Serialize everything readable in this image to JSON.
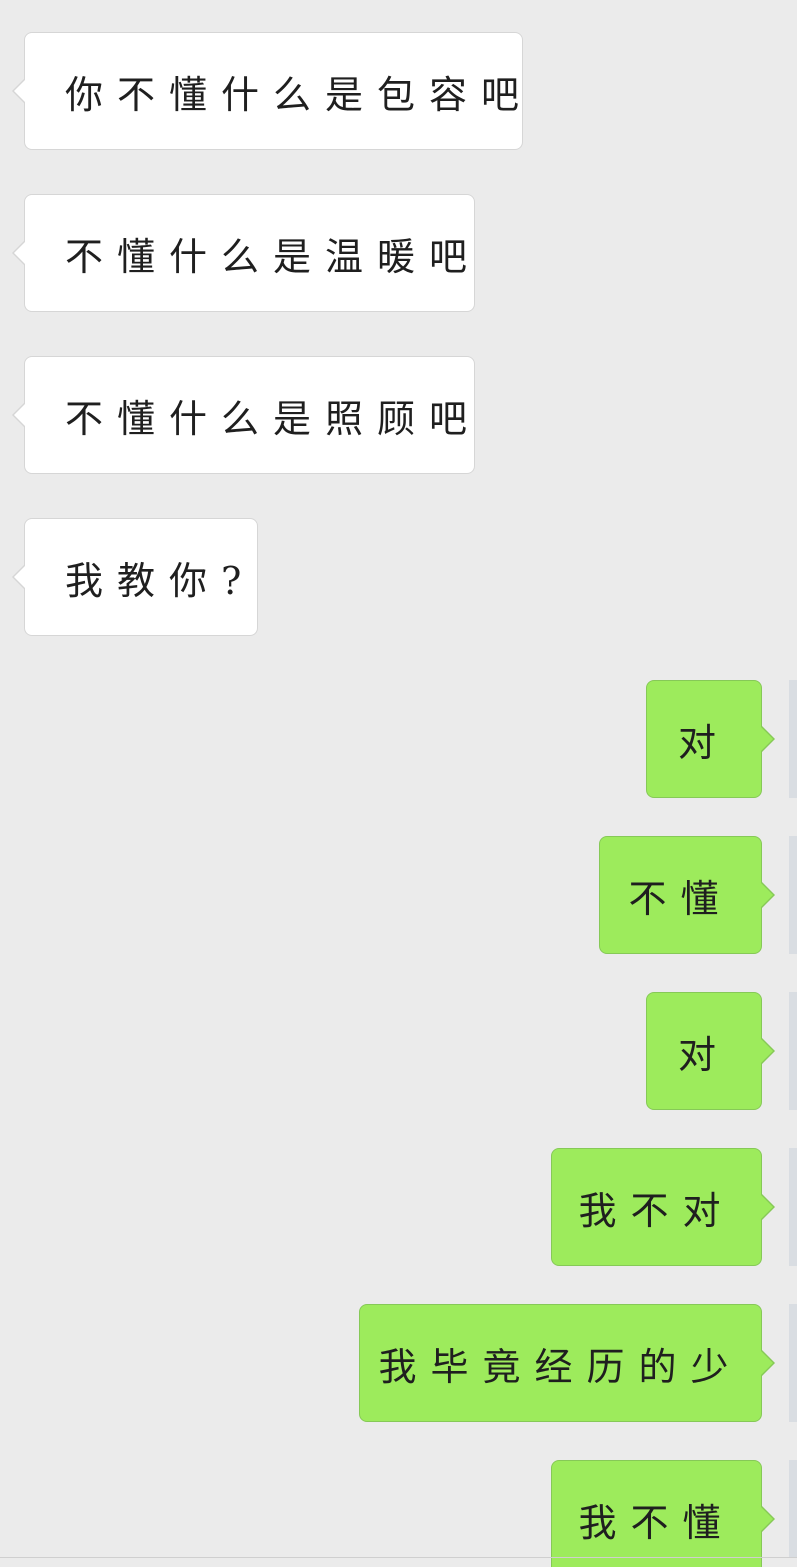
{
  "messages": [
    {
      "from": "contact",
      "text": "你不懂什么是包容吧"
    },
    {
      "from": "contact",
      "text": "不懂什么是温暖吧"
    },
    {
      "from": "contact",
      "text": "不懂什么是照顾吧"
    },
    {
      "from": "contact",
      "text": "我教你?"
    },
    {
      "from": "me",
      "text": "对"
    },
    {
      "from": "me",
      "text": "不懂"
    },
    {
      "from": "me",
      "text": "对"
    },
    {
      "from": "me",
      "text": "我不对"
    },
    {
      "from": "me",
      "text": "我毕竟经历的少"
    },
    {
      "from": "me",
      "text": "我不懂"
    }
  ],
  "colors": {
    "background": "#ebebeb",
    "incoming_bubble": "#ffffff",
    "outgoing_bubble": "#9deb5c"
  }
}
